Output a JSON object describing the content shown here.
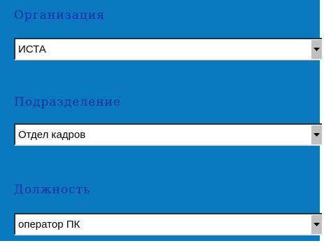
{
  "colors": {
    "panel_background": "#0a7ac0",
    "label_text": "#1b2aa8",
    "field_background": "#ffffff",
    "arrow_button": "#c0c0c0"
  },
  "form": {
    "organization": {
      "label": "Организация",
      "value": "ИСТА",
      "icon": "chevron-down-icon"
    },
    "department": {
      "label": "Подразделение",
      "value": "Отдел кадров",
      "icon": "chevron-down-icon"
    },
    "position": {
      "label": "Должность",
      "value": "оператор ПК",
      "icon": "chevron-down-icon"
    }
  }
}
